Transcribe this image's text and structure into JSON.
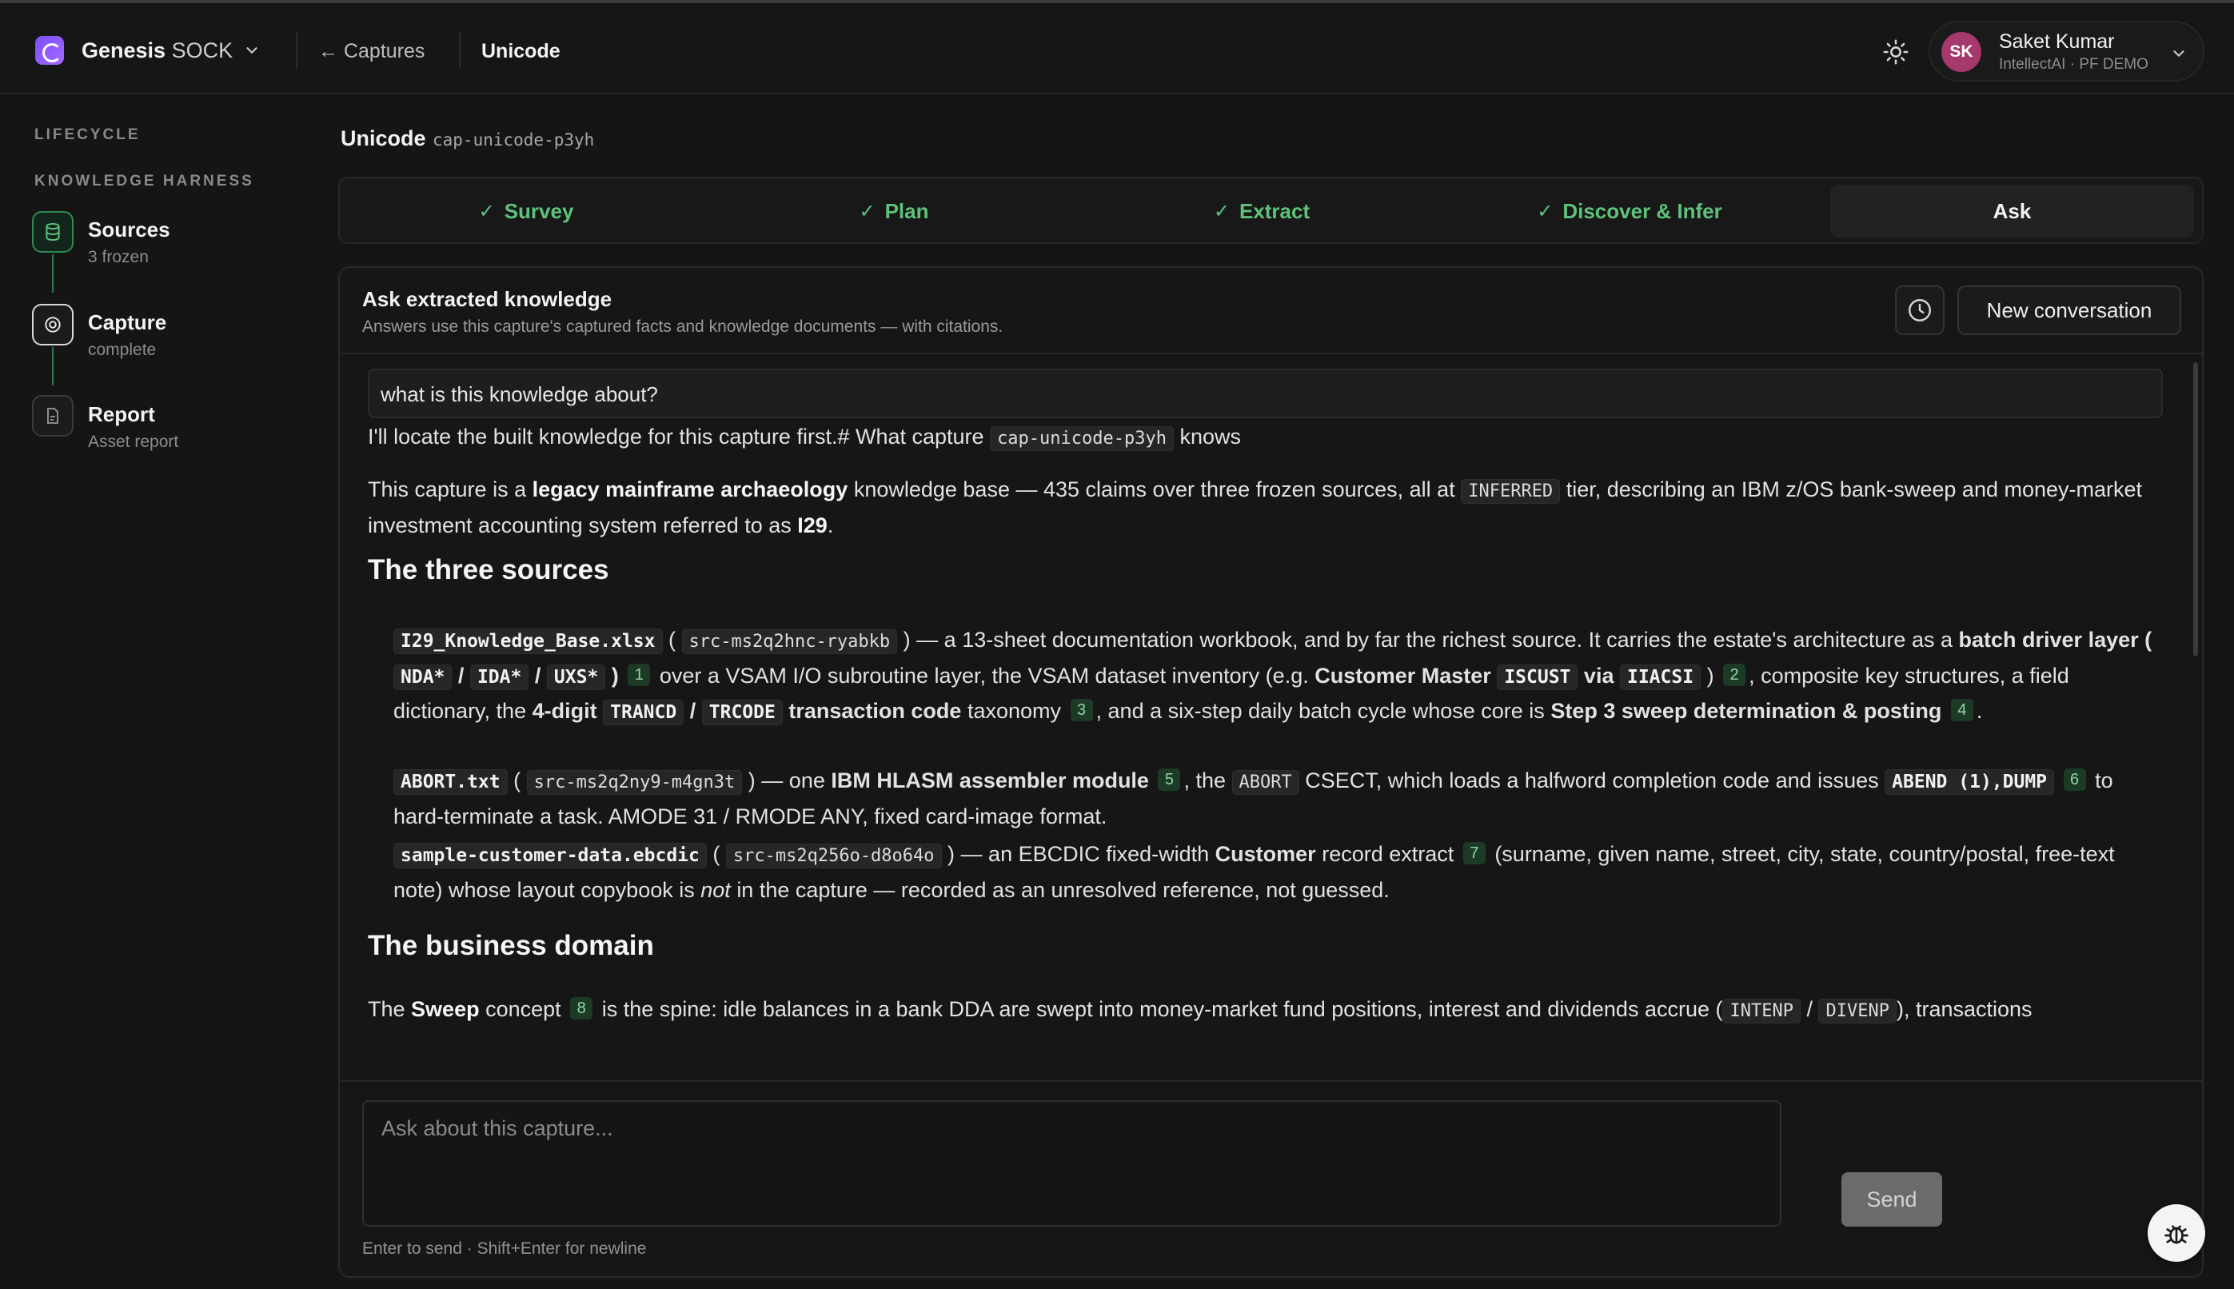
{
  "header": {
    "brand_bold": "Genesis",
    "brand_light": "SOCK",
    "back_label": "Captures",
    "current": "Unicode",
    "user": {
      "initials": "SK",
      "name": "Saket Kumar",
      "org": "IntellectAI · PF DEMO"
    }
  },
  "sidebar": {
    "section1": "LIFECYCLE",
    "section2": "KNOWLEDGE HARNESS",
    "items": [
      {
        "title": "Sources",
        "sub": "3 frozen",
        "icon": "database-icon"
      },
      {
        "title": "Capture",
        "sub": "complete",
        "icon": "target-icon"
      },
      {
        "title": "Report",
        "sub": "Asset report",
        "icon": "document-icon"
      }
    ]
  },
  "main": {
    "title": "Unicode",
    "capture_id": "cap-unicode-p3yh",
    "tabs": [
      {
        "label": "Survey",
        "done": true
      },
      {
        "label": "Plan",
        "done": true
      },
      {
        "label": "Extract",
        "done": true
      },
      {
        "label": "Discover & Infer",
        "done": true
      },
      {
        "label": "Ask",
        "active": true
      }
    ]
  },
  "panel": {
    "title": "Ask extracted knowledge",
    "subtitle": "Answers use this capture's captured facts and knowledge documents — with citations.",
    "new_conversation": "New conversation",
    "question": "what is this knowledge about?",
    "composer_placeholder": "Ask about this capture...",
    "send": "Send",
    "hint": "Enter to send · Shift+Enter for newline"
  },
  "answer": {
    "intro_text": "I'll locate the built knowledge for this capture first.# What capture",
    "intro_code": "cap-unicode-p3yh",
    "intro_tail": "knows",
    "p2": {
      "a": "This capture is a",
      "b": "legacy mainframe archaeology",
      "c": "knowledge base — 435 claims over three frozen sources, all at",
      "code": "INFERRED",
      "d": "tier, describing an IBM z/OS bank-sweep and money-market investment accounting system referred to as",
      "e": "I29",
      "f": "."
    },
    "h_sources": "The three sources",
    "s1": {
      "file": "I29_Knowledge_Base.xlsx",
      "src": "src-ms2q2hnc-ryabkb",
      "t1": "— a 13-sheet documentation workbook, and by far the richest source. It carries the estate's architecture as a",
      "b1": "batch driver layer",
      "c1": "NDA*",
      "c2": "IDA*",
      "c3": "UXS*",
      "n1": "1",
      "t2": "over a VSAM I/O subroutine layer, the VSAM dataset inventory (e.g.",
      "b2": "Customer Master",
      "c4": "ISCUST",
      "b3": "via",
      "c5": "IIACSI",
      "n2": "2",
      "t3": ", composite key structures, a field dictionary, the",
      "b4": "4-digit",
      "c6": "TRANCD",
      "c7": "TRCODE",
      "b5": "transaction code",
      "t4": "taxonomy",
      "n3": "3",
      "t5": ", and a six-step daily batch cycle whose core is",
      "b6": "Step 3 sweep determination & posting",
      "n4": "4"
    },
    "s2": {
      "file": "ABORT.txt",
      "src": "src-ms2q2ny9-m4gn3t",
      "t1": "— one",
      "b1": "IBM HLASM assembler module",
      "n1": "5",
      "t2": ", the",
      "c1": "ABORT",
      "t3": "CSECT, which loads a halfword completion code and issues",
      "c2": "ABEND (1),DUMP",
      "n2": "6",
      "t4": "to hard-terminate a task. AMODE 31 / RMODE ANY, fixed card-image format."
    },
    "s3": {
      "file": "sample-customer-data.ebcdic",
      "src": "src-ms2q256o-d8o64o",
      "t1": "— an EBCDIC fixed-width",
      "b1": "Customer",
      "t2": "record extract",
      "n1": "7",
      "t3": "(surname, given name, street, city, state, country/postal, free-text note) whose layout copybook is",
      "em": "not",
      "t4": "in the capture — recorded as an unresolved reference, not guessed."
    },
    "h_domain": "The business domain",
    "p3": {
      "a": "The",
      "b": "Sweep",
      "c": "concept",
      "n": "8",
      "d": "is the spine: idle balances in a bank DDA are swept into money-market fund positions, interest and dividends accrue (",
      "c1": "INTENP",
      "c2": "DIVENP",
      "e": "), transactions"
    }
  },
  "colors": {
    "accent_green": "#5ec27a",
    "avatar": "#a5386c",
    "brand": "#7b4dff"
  }
}
